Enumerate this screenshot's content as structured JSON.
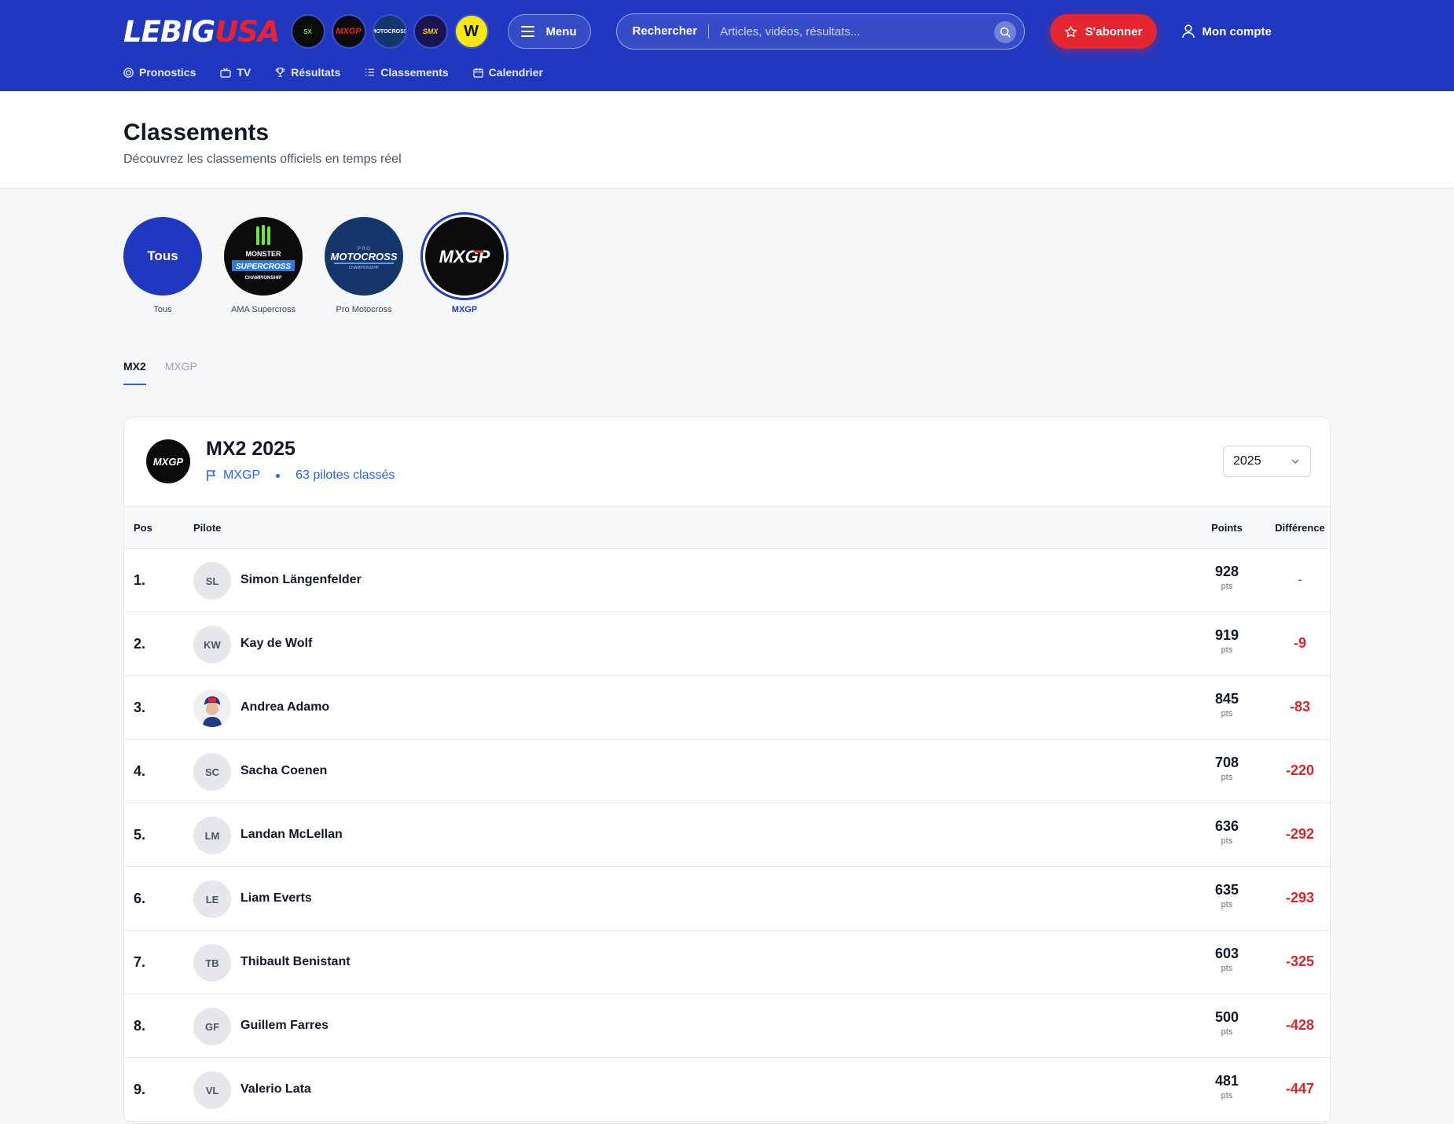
{
  "header": {
    "logo_main": "LEBIG",
    "logo_accent": "USA",
    "brands": [
      {
        "name": "monster-supercross-icon",
        "text": "SX"
      },
      {
        "name": "mxgp-icon",
        "text": "MXGP"
      },
      {
        "name": "motocross-icon",
        "text": "MOTOCROSS"
      },
      {
        "name": "smx-icon",
        "text": "SMX"
      },
      {
        "name": "w-brand-icon",
        "text": "W"
      }
    ],
    "menu_label": "Menu",
    "search_label": "Rechercher",
    "search_placeholder": "Articles, vidéos, résultats...",
    "subscribe_label": "S'abonner",
    "account_label": "Mon compte",
    "nav": [
      "Pronostics",
      "TV",
      "Résultats",
      "Classements",
      "Calendrier"
    ]
  },
  "page": {
    "title": "Classements",
    "subtitle": "Découvrez les classements officiels en temps réel"
  },
  "filters": [
    {
      "label": "Tous",
      "text": "Tous"
    },
    {
      "label": "AMA Supercross",
      "text": "SUPERCROSS"
    },
    {
      "label": "Pro Motocross",
      "text": "MOTOCROSS"
    },
    {
      "label": "MXGP",
      "text": "MXGP"
    }
  ],
  "tabs": [
    "MX2",
    "MXGP"
  ],
  "standings": {
    "title": "MX2 2025",
    "series": "MXGP",
    "count": "63 pilotes classés",
    "year": "2025",
    "columns": {
      "pos": "Pos",
      "pilot": "Pilote",
      "points": "Points",
      "diff": "Différence"
    },
    "unit": "pts",
    "rows": [
      {
        "pos": "1.",
        "initials": "SL",
        "name": "Simon Längenfelder",
        "points": "928",
        "diff": "-"
      },
      {
        "pos": "2.",
        "initials": "KW",
        "name": "Kay de Wolf",
        "points": "919",
        "diff": "-9"
      },
      {
        "pos": "3.",
        "initials": "",
        "name": "Andrea Adamo",
        "points": "845",
        "diff": "-83"
      },
      {
        "pos": "4.",
        "initials": "SC",
        "name": "Sacha Coenen",
        "points": "708",
        "diff": "-220"
      },
      {
        "pos": "5.",
        "initials": "LM",
        "name": "Landan McLellan",
        "points": "636",
        "diff": "-292"
      },
      {
        "pos": "6.",
        "initials": "LE",
        "name": "Liam Everts",
        "points": "635",
        "diff": "-293"
      },
      {
        "pos": "7.",
        "initials": "TB",
        "name": "Thibault Benistant",
        "points": "603",
        "diff": "-325"
      },
      {
        "pos": "8.",
        "initials": "GF",
        "name": "Guillem Farres",
        "points": "500",
        "diff": "-428"
      },
      {
        "pos": "9.",
        "initials": "VL",
        "name": "Valerio Lata",
        "points": "481",
        "diff": "-447"
      }
    ]
  }
}
